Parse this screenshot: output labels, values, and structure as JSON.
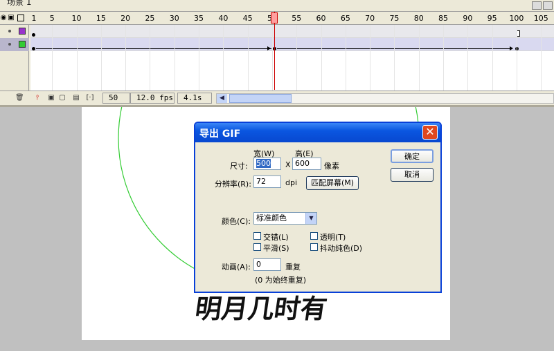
{
  "timeline": {
    "scene_label": "场景 1",
    "ruler_ticks": [
      "1",
      "5",
      "10",
      "15",
      "20",
      "25",
      "30",
      "35",
      "40",
      "45",
      "50",
      "55",
      "60",
      "65",
      "70",
      "75",
      "80",
      "85",
      "90",
      "95",
      "100",
      "105"
    ],
    "current_frame": "50",
    "frame_rate": "12.0 fps",
    "elapsed_time": "4.1s",
    "layers": [
      {
        "color": "#9933cc",
        "selected": false
      },
      {
        "color": "#33cc33",
        "selected": true
      }
    ]
  },
  "stage": {
    "circle_color": "#33cc33",
    "calligraphy_text": "明月几时有"
  },
  "dialog": {
    "title": "导出 GIF",
    "close_label": "✕",
    "width_header": "宽(W)",
    "height_header": "高(E)",
    "size_label": "尺寸:",
    "width_value": "500",
    "x_label": "X",
    "height_value": "600",
    "pixels_label": "像素",
    "resolution_label": "分辨率(R):",
    "resolution_value": "72",
    "dpi_label": "dpi",
    "match_screen_label": "匹配屏幕(M)",
    "color_label": "颜色(C):",
    "color_value": "标准颜色",
    "interlace_label": "交错(L)",
    "transparent_label": "透明(T)",
    "smooth_label": "平滑(S)",
    "dither_label": "抖动纯色(D)",
    "animation_label": "动画(A):",
    "animation_value": "0",
    "repeat_label": "重复",
    "repeat_hint": "(0 为始终重复)",
    "ok_label": "确定",
    "cancel_label": "取消"
  }
}
